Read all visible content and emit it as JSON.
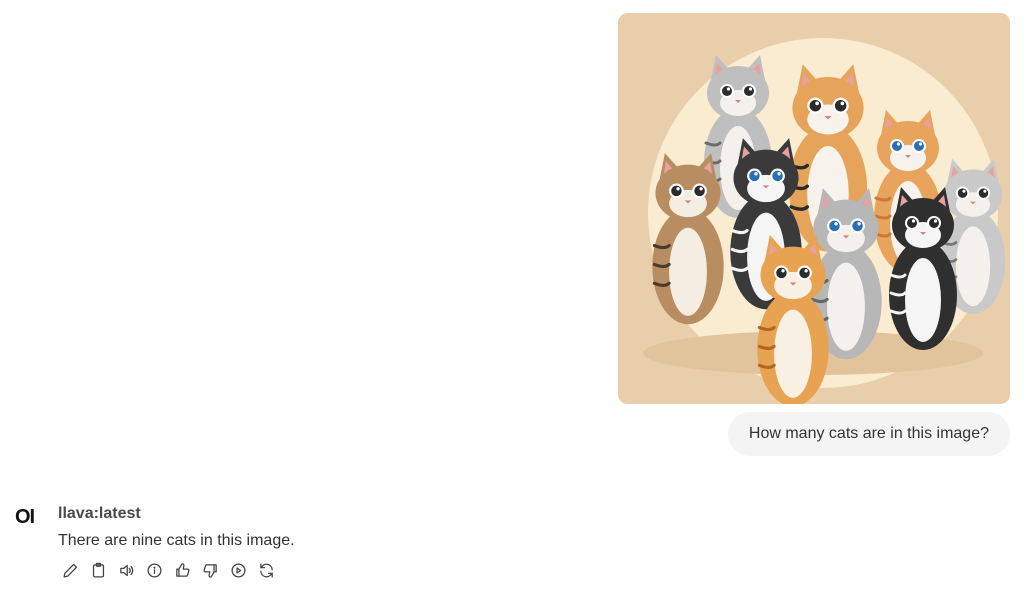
{
  "user": {
    "message": "How many cats are in this image?",
    "image_alt": "cats-illustration"
  },
  "assistant": {
    "logo_text": "OI",
    "model_name": "llava:latest",
    "message": "There are nine cats in this image."
  },
  "actions": [
    {
      "name": "edit-icon"
    },
    {
      "name": "copy-icon"
    },
    {
      "name": "read-aloud-icon"
    },
    {
      "name": "info-icon"
    },
    {
      "name": "thumbs-up-icon"
    },
    {
      "name": "thumbs-down-icon"
    },
    {
      "name": "continue-icon"
    },
    {
      "name": "regenerate-icon"
    }
  ]
}
